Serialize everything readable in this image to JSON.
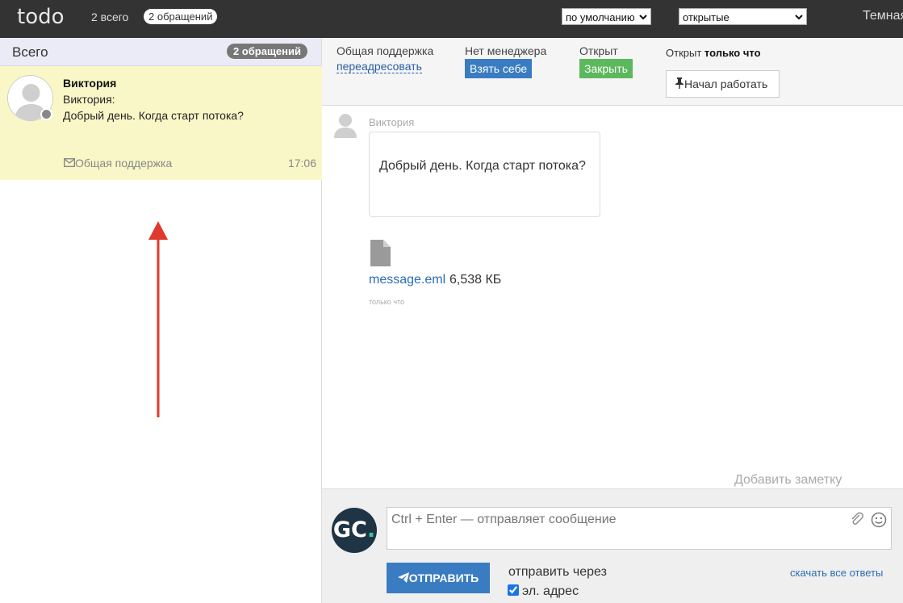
{
  "topbar": {
    "logo": "todo",
    "total": "2 всего",
    "requests_pill": "2 обращений",
    "sort_select": "по умолчанию",
    "status_select": "открытые",
    "theme_label": "Темная"
  },
  "sidebar": {
    "title": "Всего",
    "badge": "2 обращений",
    "ticket": {
      "name": "Виктория",
      "from": "Виктория:",
      "text": "Добрый день. Когда старт потока?",
      "group": "Общая поддержка",
      "time": "17:06"
    }
  },
  "header": {
    "group_label": "Общая поддержка",
    "forward_link": "переадресовать",
    "manager_label": "Нет менеджера",
    "take_button": "Взять себе",
    "status_label": "Открыт",
    "close_button": "Закрыть",
    "opened_prefix": "Открыт",
    "opened_when": "только что",
    "work_button": "Начал работать"
  },
  "message": {
    "sender": "Виктория",
    "text": "Добрый день. Когда старт потока?",
    "file_name": "message.eml",
    "file_size": "6,538 КБ",
    "time": "только что",
    "add_note": "Добавить заметку"
  },
  "compose": {
    "avatar_text": "GC",
    "avatar_dot": ".",
    "placeholder": "Ctrl + Enter — отправляет сообщение",
    "send_button": "ОТПРАВИТЬ",
    "send_via": "отправить через",
    "email_option": "эл. адрес",
    "download_all": "скачать все ответы"
  },
  "colors": {
    "topbar": "#333333",
    "ticket_highlight": "#f9f7c7",
    "primary": "#3a7cc1",
    "success": "#5cb85c",
    "annotation_arrow": "#e03a2f"
  }
}
